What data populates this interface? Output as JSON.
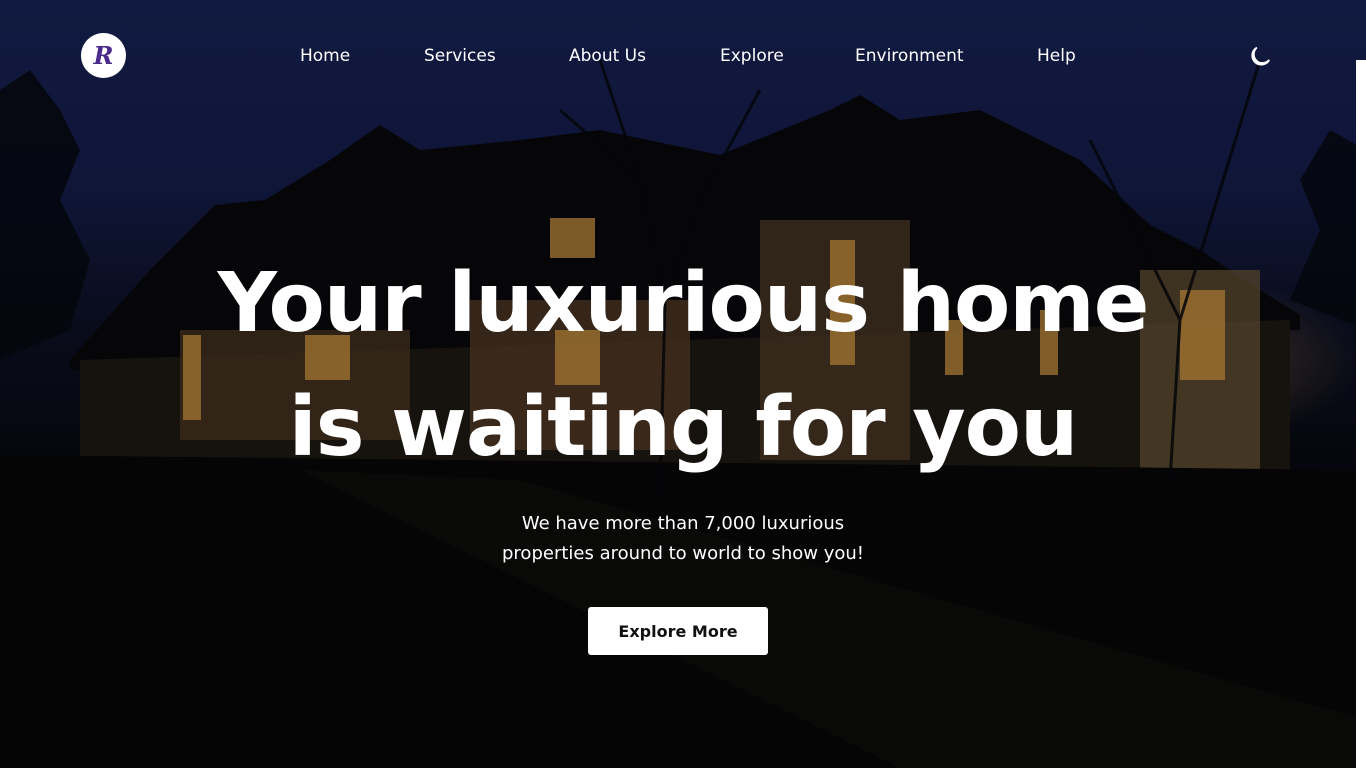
{
  "header": {
    "logo_letter": "R",
    "nav": [
      {
        "label": "Home"
      },
      {
        "label": "Services"
      },
      {
        "label": "About Us"
      },
      {
        "label": "Explore"
      },
      {
        "label": "Environment"
      },
      {
        "label": "Help"
      }
    ],
    "theme_toggle_icon": "moon-icon"
  },
  "hero": {
    "headline_line1": "Your luxurious home",
    "headline_line2": "is waiting for you",
    "subtext_line1": "We have more than 7,000 luxurious",
    "subtext_line2": "properties around to world to show you!",
    "cta_label": "Explore More"
  },
  "colors": {
    "brand_purple": "#4b2a8c",
    "night_sky": "#15204f",
    "text": "#ffffff",
    "button_bg": "#ffffff"
  }
}
